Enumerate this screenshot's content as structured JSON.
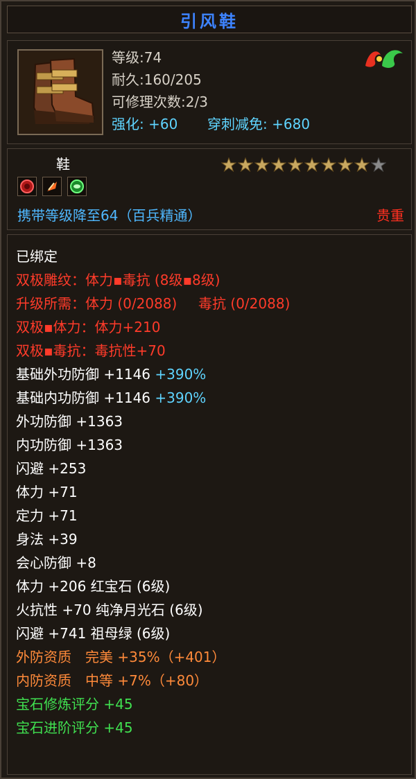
{
  "item": {
    "title": "引风鞋",
    "type": "鞋",
    "rarity": "贵重",
    "carry_level": "携带等级降至64（百兵精通）"
  },
  "basic": {
    "level": "等级:74",
    "durability": "耐久:160/205",
    "repair": "可修理次数:2/3",
    "enhance_label": "强化:",
    "enhance_value": "+60",
    "pierce_label": "穿刺减免:",
    "pierce_value": "+680"
  },
  "stars": {
    "filled": 9,
    "total": 10
  },
  "gems_icons": [
    "red-gem-icon",
    "fire-feather-icon",
    "green-gem-icon"
  ],
  "attributes": {
    "bound": "已绑定",
    "dual_carve": "双极雕纹：体力▪毒抗 (8级▪8级)",
    "upgrade_need_a": "升级所需：体力 (0/2088)",
    "upgrade_need_b": "毒抗 (0/2088)",
    "dual_con": "双极▪体力：体力+210",
    "dual_poison": "双极▪毒抗：毒抗性+70",
    "base_ext_def": "基础外功防御 +1146",
    "base_ext_def_pct": "+390%",
    "base_int_def": "基础内功防御 +1146",
    "base_int_def_pct": "+390%",
    "ext_def": "外功防御 +1363",
    "int_def": "内功防御 +1363",
    "dodge": "闪避 +253",
    "con": "体力 +71",
    "focus": "定力 +71",
    "agility": "身法 +39",
    "crit_def": "会心防御 +8",
    "gem1": "体力 +206 红宝石 (6级)",
    "gem2": "火抗性 +70 纯净月光石 (6级)",
    "gem3": "闪避 +741 祖母绿 (6级)",
    "ext_quality": "外防资质　完美 +35%（+401）",
    "int_quality": "内防资质　中等 +7%（+80）",
    "gem_refine": "宝石修炼评分 +45",
    "gem_advance": "宝石进阶评分 +45"
  },
  "colors": {
    "title": "#3d83ff",
    "red_text": "#ff3b2a",
    "cyan_text": "#5fd4ff",
    "green_text": "#40e050",
    "orange_text": "#ff8a3a",
    "star": "#c8a860"
  }
}
